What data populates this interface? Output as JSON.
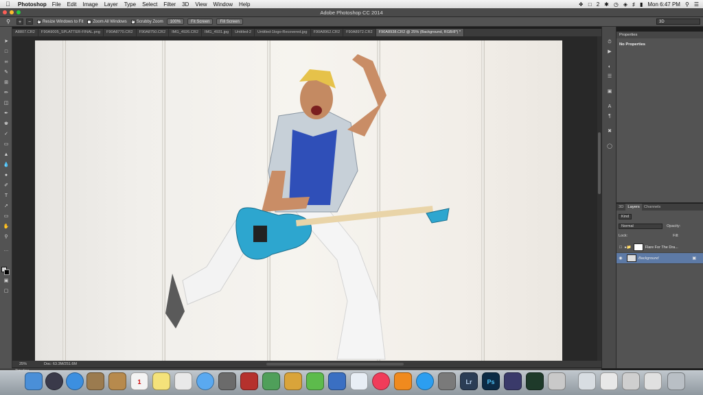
{
  "menubar": {
    "app_name": "Photoshop",
    "items": [
      "File",
      "Edit",
      "Image",
      "Layer",
      "Type",
      "Select",
      "Filter",
      "3D",
      "View",
      "Window",
      "Help"
    ],
    "status_count": "2",
    "clock": "Mon 6:47 PM"
  },
  "window": {
    "title": "Adobe Photoshop CC 2014"
  },
  "options_bar": {
    "resize_windows": "Resize Windows to Fit",
    "zoom_all": "Zoom All Windows",
    "scrubby_zoom": "Scrubby Zoom",
    "zoom_100": "100%",
    "fit_screen": "Fit Screen",
    "fill_screen": "Fill Screen",
    "workspace": "3D"
  },
  "tabs": [
    "A8807.CR2",
    "F90A9005_SPLATTER-FINAL.png",
    "F90A8770.CR2",
    "F90A8750.CR2",
    "IMG_4926.CR2",
    "IMG_4931.jpg",
    "Untitled-2",
    "Untitled-1logo-Recovered.jpg",
    "F90A8962.CR2",
    "F90A8972.CR2",
    "F90A8938.CR2 @ 25% (Background, RGB/8*) *"
  ],
  "status": {
    "zoom": "25%",
    "doc": "Doc: 63.3M/251.6M",
    "timeline": "Timeline"
  },
  "properties": {
    "title": "Properties",
    "body": "No Properties"
  },
  "layers_panel": {
    "tabs": [
      "3D",
      "Layers",
      "Channels"
    ],
    "kind": "Kind",
    "blend_mode": "Normal",
    "opacity_label": "Opacity:",
    "lock_label": "Lock:",
    "fill_label": "Fill:",
    "layers": [
      {
        "name": "Flare For The Dra..."
      },
      {
        "name": "Background"
      }
    ]
  },
  "colors": {
    "accent_selected_layer": "#5d7aa6",
    "photo_guitar": "#2da6cf"
  }
}
